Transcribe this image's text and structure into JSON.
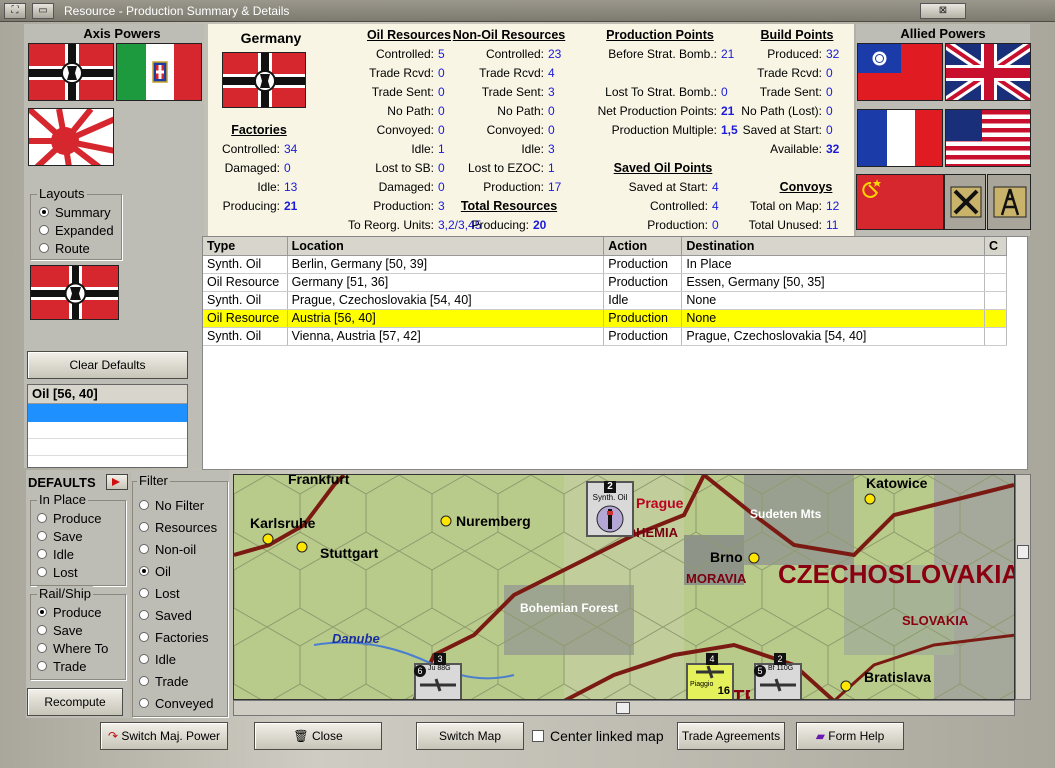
{
  "window": {
    "title": "Resource - Production Summary & Details"
  },
  "left": {
    "axis_header": "Axis Powers",
    "layouts_label": "Layouts",
    "layouts": [
      {
        "label": "Summary",
        "selected": true
      },
      {
        "label": "Expanded",
        "selected": false
      },
      {
        "label": "Route",
        "selected": false
      }
    ],
    "clear_defaults": "Clear Defaults",
    "list_header": "Oil [56, 40]",
    "defaults_label": "DEFAULTS",
    "in_place_label": "In Place",
    "in_place": [
      {
        "label": "Produce",
        "selected": false
      },
      {
        "label": "Save",
        "selected": false
      },
      {
        "label": "Idle",
        "selected": false
      },
      {
        "label": "Lost",
        "selected": false
      }
    ],
    "rail_ship_label": "Rail/Ship",
    "rail_ship": [
      {
        "label": "Produce",
        "selected": true
      },
      {
        "label": "Save",
        "selected": false
      },
      {
        "label": "Where To",
        "selected": false
      },
      {
        "label": "Trade",
        "selected": false
      }
    ],
    "recompute": "Recompute",
    "filter_label": "Filter",
    "filters": [
      {
        "label": "No Filter",
        "selected": false
      },
      {
        "label": "Resources",
        "selected": false
      },
      {
        "label": "Non-oil",
        "selected": false
      },
      {
        "label": "Oil",
        "selected": true
      },
      {
        "label": "Lost",
        "selected": false
      },
      {
        "label": "Saved",
        "selected": false
      },
      {
        "label": "Factories",
        "selected": false
      },
      {
        "label": "Idle",
        "selected": false
      },
      {
        "label": "Trade",
        "selected": false
      },
      {
        "label": "Conveyed",
        "selected": false
      }
    ]
  },
  "info": {
    "country": "Germany",
    "factories": {
      "title": "Factories",
      "rows": [
        {
          "label": "Controlled:",
          "value": "34"
        },
        {
          "label": "Damaged:",
          "value": "0"
        },
        {
          "label": "Idle:",
          "value": "13"
        },
        {
          "label": "Producing:",
          "value": "21"
        }
      ]
    },
    "oil": {
      "title": "Oil Resources",
      "rows": [
        {
          "label": "Controlled:",
          "value": "5"
        },
        {
          "label": "Trade Rcvd:",
          "value": "0"
        },
        {
          "label": "Trade Sent:",
          "value": "0"
        },
        {
          "label": "No Path:",
          "value": "0"
        },
        {
          "label": "Convoyed:",
          "value": "0"
        },
        {
          "label": "Idle:",
          "value": "1"
        },
        {
          "label": "Lost to SB:",
          "value": "0"
        },
        {
          "label": "Damaged:",
          "value": "0"
        },
        {
          "label": "Production:",
          "value": "3"
        },
        {
          "label": "To Reorg. Units:",
          "value": "3,2/3,45"
        }
      ]
    },
    "nonoil": {
      "title": "Non-Oil Resources",
      "rows": [
        {
          "label": "Controlled:",
          "value": "23"
        },
        {
          "label": "Trade Rcvd:",
          "value": "4"
        },
        {
          "label": "Trade Sent:",
          "value": "3"
        },
        {
          "label": "No Path:",
          "value": "0"
        },
        {
          "label": "Convoyed:",
          "value": "0"
        },
        {
          "label": "Idle:",
          "value": "3"
        },
        {
          "label": "Lost to EZOC:",
          "value": "1"
        },
        {
          "label": "Production:",
          "value": "17"
        }
      ]
    },
    "total": {
      "title": "Total Resources",
      "rows": [
        {
          "label": "Producing:",
          "value": "20"
        }
      ]
    },
    "pp": {
      "title": "Production Points",
      "rows": [
        {
          "label": "Before Strat. Bomb.:",
          "value": "21"
        },
        {
          "label": "",
          "value": ""
        },
        {
          "label": "Lost To Strat. Bomb.:",
          "value": "0"
        },
        {
          "label": "Net Production Points:",
          "value": "21"
        },
        {
          "label": "Production Multiple:",
          "value": "1,5"
        }
      ]
    },
    "saved_oil": {
      "title": "Saved Oil Points",
      "rows": [
        {
          "label": "Saved at Start:",
          "value": "4"
        },
        {
          "label": "Controlled:",
          "value": "4"
        },
        {
          "label": "Production:",
          "value": "0"
        }
      ]
    },
    "bp": {
      "title": "Build Points",
      "rows": [
        {
          "label": "Produced:",
          "value": "32"
        },
        {
          "label": "Trade Rcvd:",
          "value": "0"
        },
        {
          "label": "Trade Sent:",
          "value": "0"
        },
        {
          "label": "No Path (Lost):",
          "value": "0"
        },
        {
          "label": "Saved at Start:",
          "value": "0"
        },
        {
          "label": "Available:",
          "value": "32"
        }
      ]
    },
    "convoys": {
      "title": "Convoys",
      "rows": [
        {
          "label": "Total on Map:",
          "value": "12"
        },
        {
          "label": "Total Unused:",
          "value": "11"
        }
      ]
    }
  },
  "right": {
    "allied_header": "Allied Powers"
  },
  "table": {
    "columns": [
      "Type",
      "Location",
      "Action",
      "Destination",
      "C"
    ],
    "rows": [
      {
        "cells": [
          "Synth. Oil",
          "Berlin, Germany [50, 39]",
          "Production",
          "In Place",
          ""
        ],
        "selected": false
      },
      {
        "cells": [
          "Oil Resource",
          "Germany [51, 36]",
          "Production",
          "Essen, Germany [50, 35]",
          ""
        ],
        "selected": false
      },
      {
        "cells": [
          "Synth. Oil",
          "Prague, Czechoslovakia [54, 40]",
          "Idle",
          "None",
          ""
        ],
        "selected": false
      },
      {
        "cells": [
          "Oil Resource",
          "Austria [56, 40]",
          "Production",
          "None",
          ""
        ],
        "selected": true
      },
      {
        "cells": [
          "Synth. Oil",
          "Vienna, Austria [57, 42]",
          "Production",
          "Prague, Czechoslovakia [54, 40]",
          ""
        ],
        "selected": false
      }
    ]
  },
  "map": {
    "labels": [
      "Frankfurt",
      "Karlsruhe",
      "Stuttgart",
      "Nuremberg",
      "Prague",
      "BOHEMIA",
      "Sudeten Mts",
      "Katowice",
      "Brno",
      "MORAVIA",
      "CZECHOSLOVAKIA",
      "SLOVAKIA",
      "Bohemian Forest",
      "Danube",
      "Bratislava",
      "AUSTRIA"
    ],
    "units": [
      {
        "label": "Synth. Oil",
        "count": "2"
      },
      {
        "label": "Ju 88G",
        "count": "6",
        "stack": "3"
      },
      {
        "label": "Piaggio",
        "value": "16",
        "stack": "4"
      },
      {
        "label": "Bf 110G",
        "count": "5",
        "stack": "2"
      }
    ]
  },
  "bottom": {
    "switch_power": "Switch Maj. Power",
    "close": "Close",
    "switch_map": "Switch Map",
    "center_linked": "Center linked map",
    "trade": "Trade Agreements",
    "form_help": "Form Help"
  },
  "colors": {
    "value_blue": "#1a1ad8",
    "selected_row": "#ffff00",
    "hex_border": "#7a1a12"
  }
}
